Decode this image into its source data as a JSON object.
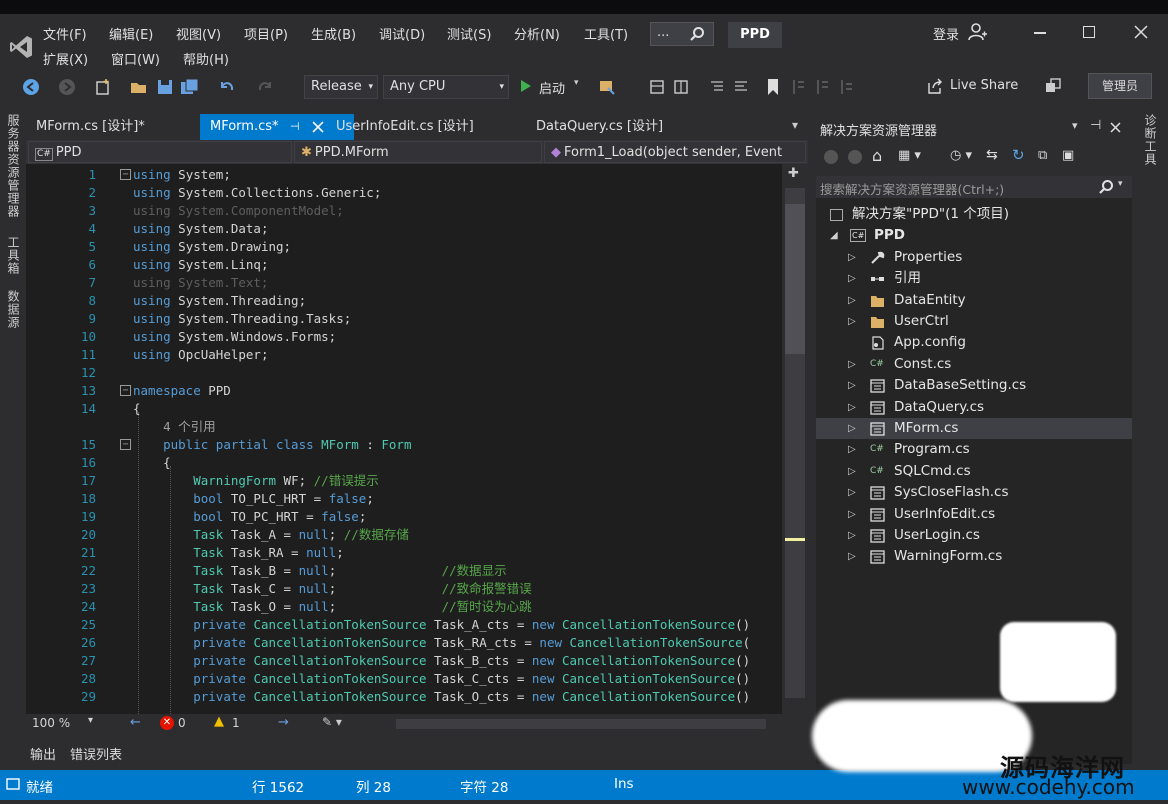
{
  "menu": {
    "row1": [
      "文件(F)",
      "编辑(E)",
      "视图(V)",
      "项目(P)",
      "生成(B)",
      "调试(D)",
      "测试(S)",
      "分析(N)",
      "工具(T)"
    ],
    "row2": [
      "扩展(X)",
      "窗口(W)",
      "帮助(H)"
    ],
    "search_text": "...",
    "solution_title": "PPD",
    "login": "登录"
  },
  "toolbar": {
    "config": "Release",
    "platform": "Any CPU",
    "start": "启动",
    "live_share": "Live Share",
    "admin": "管理员"
  },
  "left_strip": [
    "服务器资源管理器",
    "工具箱",
    "数据源"
  ],
  "right_strip": "诊断工具",
  "tabs": [
    "MForm.cs [设计]*",
    "MForm.cs*",
    "UserInfoEdit.cs [设计]",
    "DataQuery.cs [设计]"
  ],
  "navbar": {
    "project": "PPD",
    "class": "PPD.MForm",
    "member": "Form1_Load(object sender, Event"
  },
  "code_lines": [
    {
      "n": "1",
      "html": "<span class=\"kw\">using</span> System;"
    },
    {
      "n": "2",
      "html": "<span class=\"kw\">using</span> System.Collections.Generic;"
    },
    {
      "n": "3",
      "html": "<span class=\"dim\">using System.ComponentModel;</span>"
    },
    {
      "n": "4",
      "html": "<span class=\"kw\">using</span> System.Data;"
    },
    {
      "n": "5",
      "html": "<span class=\"kw\">using</span> System.Drawing;"
    },
    {
      "n": "6",
      "html": "<span class=\"kw\">using</span> System.Linq;"
    },
    {
      "n": "7",
      "html": "<span class=\"dim\">using System.Text;</span>"
    },
    {
      "n": "8",
      "html": "<span class=\"kw\">using</span> System.Threading;"
    },
    {
      "n": "9",
      "html": "<span class=\"kw\">using</span> System.Threading.Tasks;"
    },
    {
      "n": "10",
      "html": "<span class=\"kw\">using</span> System.Windows.Forms;"
    },
    {
      "n": "11",
      "html": "<span class=\"kw\">using</span> OpcUaHelper;"
    },
    {
      "n": "12",
      "html": ""
    },
    {
      "n": "13",
      "html": "<span class=\"kw\">namespace</span> PPD"
    },
    {
      "n": "14",
      "html": "{"
    },
    {
      "n": "",
      "html": "    <span style=\"color:#a0a0a0\">4 个引用</span>"
    },
    {
      "n": "15",
      "html": "    <span class=\"kw\">public partial class</span> <span class=\"ty\">MForm</span> : <span class=\"ty\">Form</span>"
    },
    {
      "n": "16",
      "html": "    {"
    },
    {
      "n": "17",
      "html": "        <span class=\"ty\">WarningForm</span> WF; <span class=\"cm\">//错误提示</span>"
    },
    {
      "n": "18",
      "html": "        <span class=\"kw\">bool</span> TO_PLC_HRT = <span class=\"kw\">false</span>;"
    },
    {
      "n": "19",
      "html": "        <span class=\"kw\">bool</span> TO_PC_HRT = <span class=\"kw\">false</span>;"
    },
    {
      "n": "20",
      "html": "        <span class=\"ty\">Task</span> Task_A = <span class=\"kw\">null</span>; <span class=\"cm\">//数据存储</span>"
    },
    {
      "n": "21",
      "html": "        <span class=\"ty\">Task</span> Task_RA = <span class=\"kw\">null</span>;"
    },
    {
      "n": "22",
      "html": "        <span class=\"ty\">Task</span> Task_B = <span class=\"kw\">null</span>;              <span class=\"cm\">//数据显示</span>"
    },
    {
      "n": "23",
      "html": "        <span class=\"ty\">Task</span> Task_C = <span class=\"kw\">null</span>;              <span class=\"cm\">//致命报警错误</span>"
    },
    {
      "n": "24",
      "html": "        <span class=\"ty\">Task</span> Task_O = <span class=\"kw\">null</span>;              <span class=\"cm\">//暂时设为心跳</span>"
    },
    {
      "n": "25",
      "html": "        <span class=\"kw\">private</span> <span class=\"ty\">CancellationTokenSource</span> Task_A_cts = <span class=\"kw\">new</span> <span class=\"ty\">CancellationTokenSource</span>()"
    },
    {
      "n": "26",
      "html": "        <span class=\"kw\">private</span> <span class=\"ty\">CancellationTokenSource</span> Task_RA_cts = <span class=\"kw\">new</span> <span class=\"ty\">CancellationTokenSource</span>("
    },
    {
      "n": "27",
      "html": "        <span class=\"kw\">private</span> <span class=\"ty\">CancellationTokenSource</span> Task_B_cts = <span class=\"kw\">new</span> <span class=\"ty\">CancellationTokenSource</span>()"
    },
    {
      "n": "28",
      "html": "        <span class=\"kw\">private</span> <span class=\"ty\">CancellationTokenSource</span> Task_C_cts = <span class=\"kw\">new</span> <span class=\"ty\">CancellationTokenSource</span>()"
    },
    {
      "n": "29",
      "html": "        <span class=\"kw\">private</span> <span class=\"ty\">CancellationTokenSource</span> Task_O_cts = <span class=\"kw\">new</span> <span class=\"ty\">CancellationTokenSource</span>()"
    }
  ],
  "editor_status": {
    "zoom": "100 %",
    "errors": "0",
    "warnings": "1"
  },
  "output_tabs": [
    "输出",
    "错误列表"
  ],
  "solution_explorer": {
    "title": "解决方案资源管理器",
    "search_placeholder": "搜索解决方案资源管理器(Ctrl+;)",
    "solution": "解决方案\"PPD\"(1 个项目)",
    "project": "PPD",
    "items": [
      {
        "label": "Properties",
        "icon": "wrench-icon"
      },
      {
        "label": "引用",
        "icon": "references-icon"
      },
      {
        "label": "DataEntity",
        "icon": "folder-icon"
      },
      {
        "label": "UserCtrl",
        "icon": "folder-icon"
      },
      {
        "label": "App.config",
        "icon": "config-file-icon"
      },
      {
        "label": "Const.cs",
        "icon": "csharp-file-icon"
      },
      {
        "label": "DataBaseSetting.cs",
        "icon": "form-file-icon"
      },
      {
        "label": "DataQuery.cs",
        "icon": "form-file-icon"
      },
      {
        "label": "MForm.cs",
        "icon": "form-file-icon"
      },
      {
        "label": "Program.cs",
        "icon": "csharp-file-icon"
      },
      {
        "label": "SQLCmd.cs",
        "icon": "csharp-file-icon"
      },
      {
        "label": "SysCloseFlash.cs",
        "icon": "form-file-icon"
      },
      {
        "label": "UserInfoEdit.cs",
        "icon": "form-file-icon"
      },
      {
        "label": "UserLogin.cs",
        "icon": "form-file-icon"
      },
      {
        "label": "WarningForm.cs",
        "icon": "form-file-icon"
      }
    ]
  },
  "statusbar": {
    "ready": "就绪",
    "line": "行 1562",
    "col": "列 28",
    "char": "字符 28",
    "ins": "Ins"
  },
  "watermark": {
    "cn": "源码海洋网",
    "url": "www.codehy.com"
  },
  "colors": {
    "accent": "#007acc",
    "editor_bg": "#1e1e1e",
    "keyword": "#569cd6",
    "type": "#4ec9b0",
    "comment": "#57a64a"
  }
}
